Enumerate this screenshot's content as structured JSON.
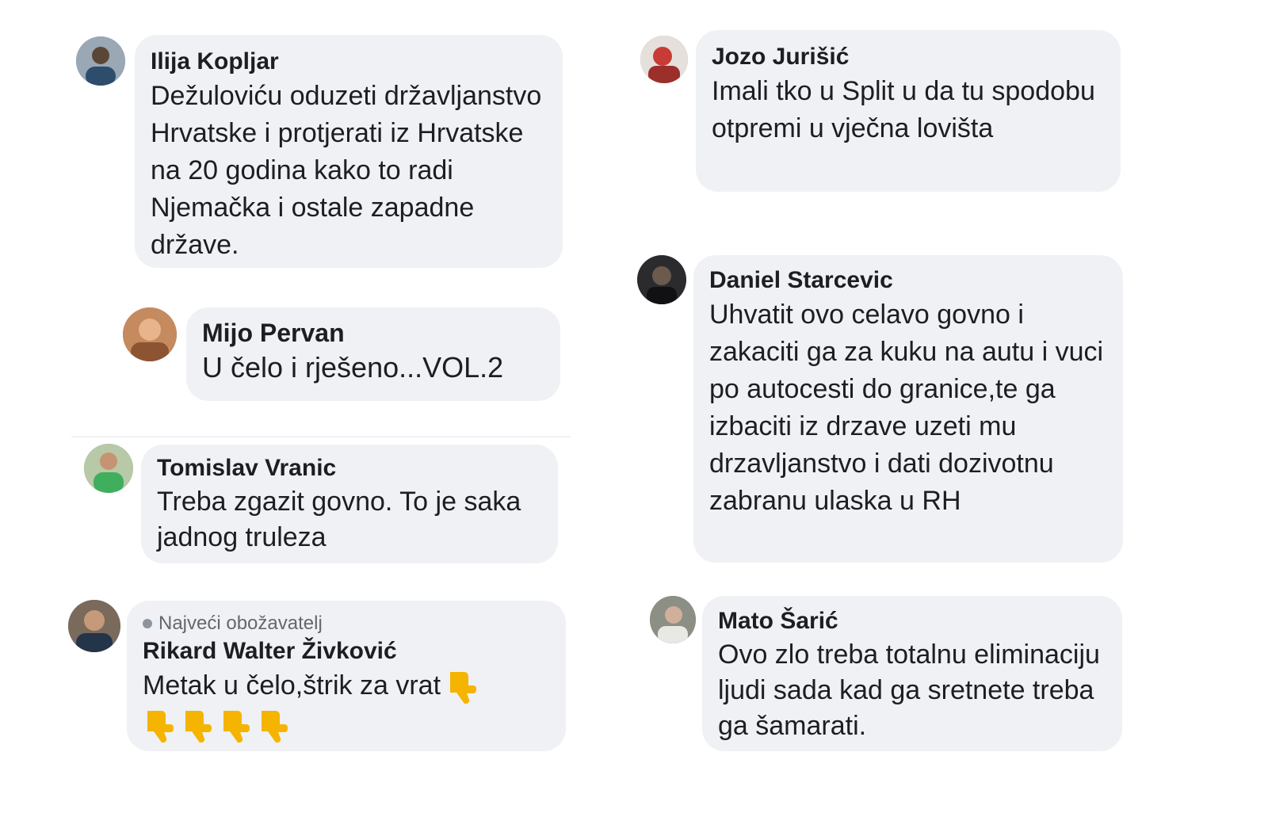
{
  "comments": [
    {
      "id": "ilija",
      "author": "Ilija Kopljar",
      "text": "Dežuloviću oduzeti državljanstvo Hrvatske i protjerati iz Hrvatske na 20 godina kako to radi Njemačka i ostale zapadne države."
    },
    {
      "id": "mijo",
      "author": "Mijo Pervan",
      "text": "U čelo i rješeno...VOL.2"
    },
    {
      "id": "tomislav",
      "author": "Tomislav Vranic",
      "text": "Treba zgazit govno. To je saka jadnog truleza"
    },
    {
      "id": "rikard",
      "badge": "Najveći obožavatelj",
      "author": "Rikard Walter Živković",
      "text": "Metak u čelo,štrik za vrat",
      "emoji": "thumbs-down-icon"
    },
    {
      "id": "jozo",
      "author": "Jozo Jurišić",
      "text": "Imali tko u Split u da tu spodobu otpremi u vječna lovišta"
    },
    {
      "id": "daniel",
      "author": "Daniel Starcevic",
      "text": "Uhvatit ovo celavo govno i zakaciti ga za kuku na autu i vuci po autocesti do granice,te ga izbaciti iz drzave uzeti mu drzavljanstvo i dati dozivotnu zabranu ulaska u RH"
    },
    {
      "id": "mato",
      "author": "Mato Šarić",
      "text": "Ovo zlo treba totalnu eliminaciju ljudi sada kad ga sretnete treba ga šamarati."
    }
  ],
  "colors": {
    "bubble": "#eff1f4",
    "text": "#1c1e21",
    "muted": "#65676b",
    "emoji": "#f5b400"
  }
}
